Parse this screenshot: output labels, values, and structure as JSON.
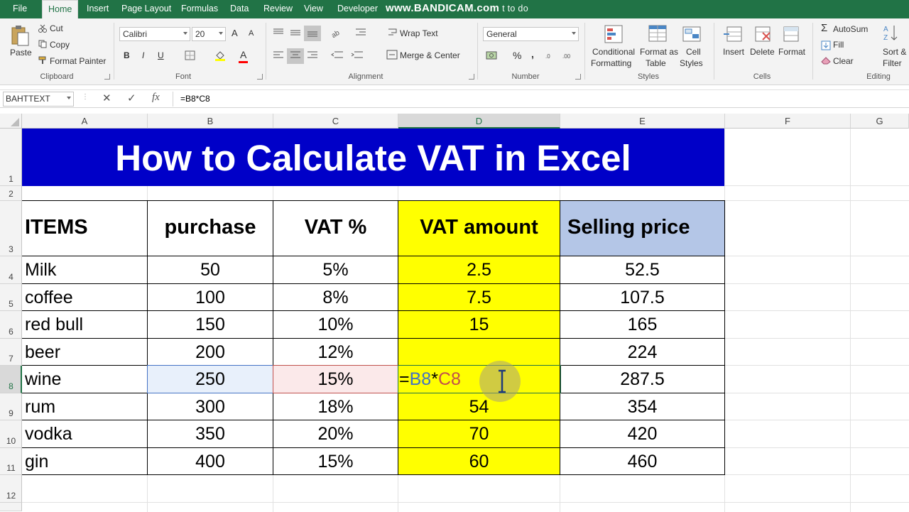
{
  "tabs": [
    "File",
    "Home",
    "Insert",
    "Page Layout",
    "Formulas",
    "Data",
    "Review",
    "View",
    "Developer"
  ],
  "active_tab": "Home",
  "watermark": {
    "text": "www.BANDICAM.com",
    "trailing": "t to do"
  },
  "clipboard": {
    "paste": "Paste",
    "cut": "Cut",
    "copy": "Copy",
    "format_painter": "Format Painter",
    "label": "Clipboard"
  },
  "font": {
    "name": "Calibri",
    "size": "20",
    "label": "Font",
    "bold": "B",
    "italic": "I",
    "underline": "U",
    "grow": "A",
    "shrink": "A",
    "color_letter": "A"
  },
  "alignment": {
    "wrap": "Wrap Text",
    "merge": "Merge & Center",
    "label": "Alignment"
  },
  "number": {
    "format": "General",
    "percent": "%",
    "comma": ",",
    "label": "Number"
  },
  "styles": {
    "conditional": "Conditional",
    "conditional2": "Formatting",
    "format_as": "Format as",
    "format_as2": "Table",
    "cell": "Cell",
    "cell2": "Styles",
    "label": "Styles"
  },
  "cells": {
    "insert": "Insert",
    "delete": "Delete",
    "format": "Format",
    "label": "Cells"
  },
  "editing": {
    "autosum": "AutoSum",
    "fill": "Fill",
    "clear": "Clear",
    "sort": "Sort &",
    "filter": "Filter",
    "label": "Editing"
  },
  "formula_bar": {
    "name_box": "BAHTTEXT",
    "cancel": "✕",
    "enter": "✓",
    "fx": "fx",
    "formula": "=B8*C8"
  },
  "columns": [
    "A",
    "B",
    "C",
    "D",
    "E",
    "F",
    "G"
  ],
  "rows": [
    "1",
    "2",
    "3",
    "4",
    "5",
    "6",
    "7",
    "8",
    "9",
    "10",
    "11",
    "12"
  ],
  "sheet": {
    "title": "How to Calculate VAT in Excel",
    "headers": [
      "ITEMS",
      "purchase",
      "VAT %",
      "VAT amount",
      "Selling price"
    ],
    "data": [
      [
        "Milk",
        "50",
        "5%",
        "2.5",
        "52.5"
      ],
      [
        "coffee",
        "100",
        "8%",
        "7.5",
        "107.5"
      ],
      [
        "red bull",
        "150",
        "10%",
        "15",
        "165"
      ],
      [
        "beer",
        "200",
        "12%",
        "",
        "224"
      ],
      [
        "wine",
        "250",
        "15%",
        "",
        "287.5"
      ],
      [
        "rum",
        "300",
        "18%",
        "54",
        "354"
      ],
      [
        "vodka",
        "350",
        "20%",
        "70",
        "420"
      ],
      [
        "gin",
        "400",
        "15%",
        "60",
        "460"
      ]
    ],
    "editing_formula": {
      "eq": "=",
      "ref1": "B8",
      "op": "*",
      "ref2": "C8"
    }
  },
  "colors": {
    "excel_green": "#217346",
    "title_bg": "#0000c8",
    "vat_col": "#ffff00",
    "selling_hdr": "#b4c6e7",
    "ref_b": "#4472c4",
    "ref_c": "#c0504d"
  }
}
